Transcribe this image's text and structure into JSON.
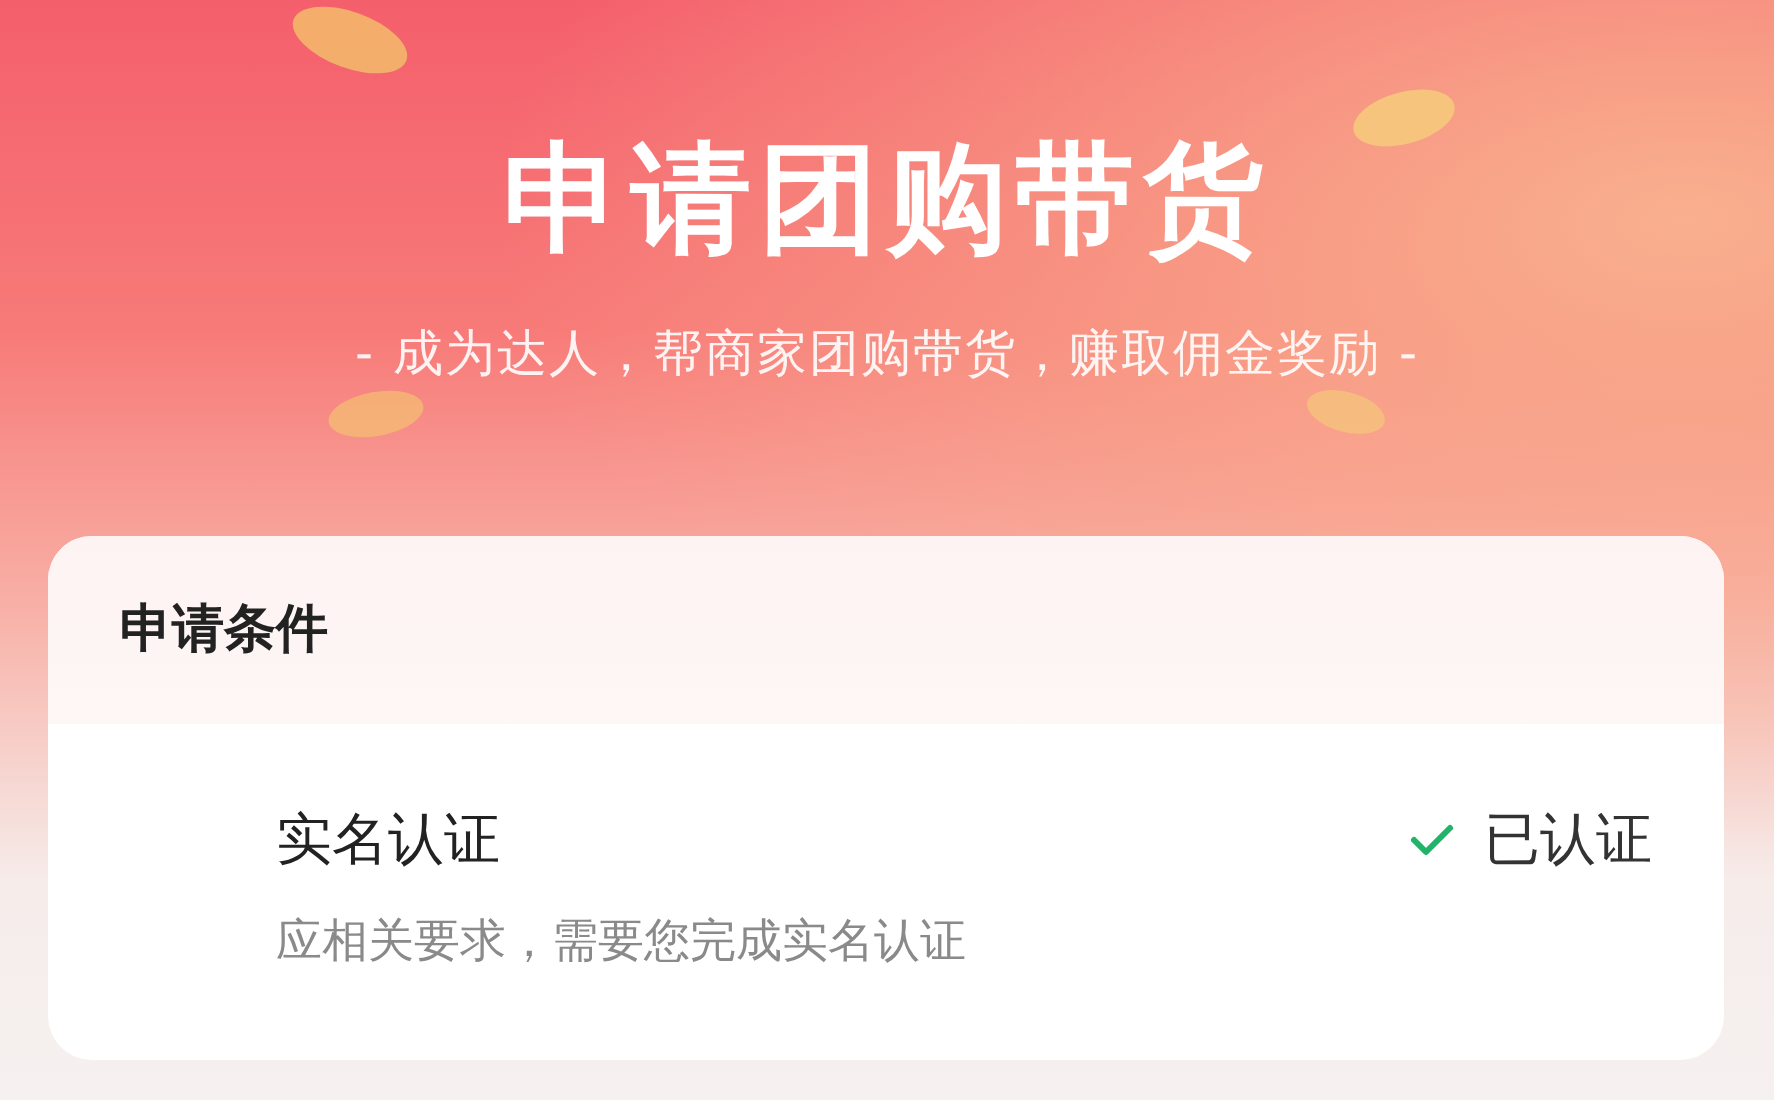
{
  "banner": {
    "title": "申请团购带货",
    "subtitle": "- 成为达人，帮商家团购带货，赚取佣金奖励 -"
  },
  "conditions": {
    "heading": "申请条件",
    "items": [
      {
        "name": "实名认证",
        "description": "应相关要求，需要您完成实名认证",
        "status": "已认证",
        "verified": true
      }
    ]
  }
}
